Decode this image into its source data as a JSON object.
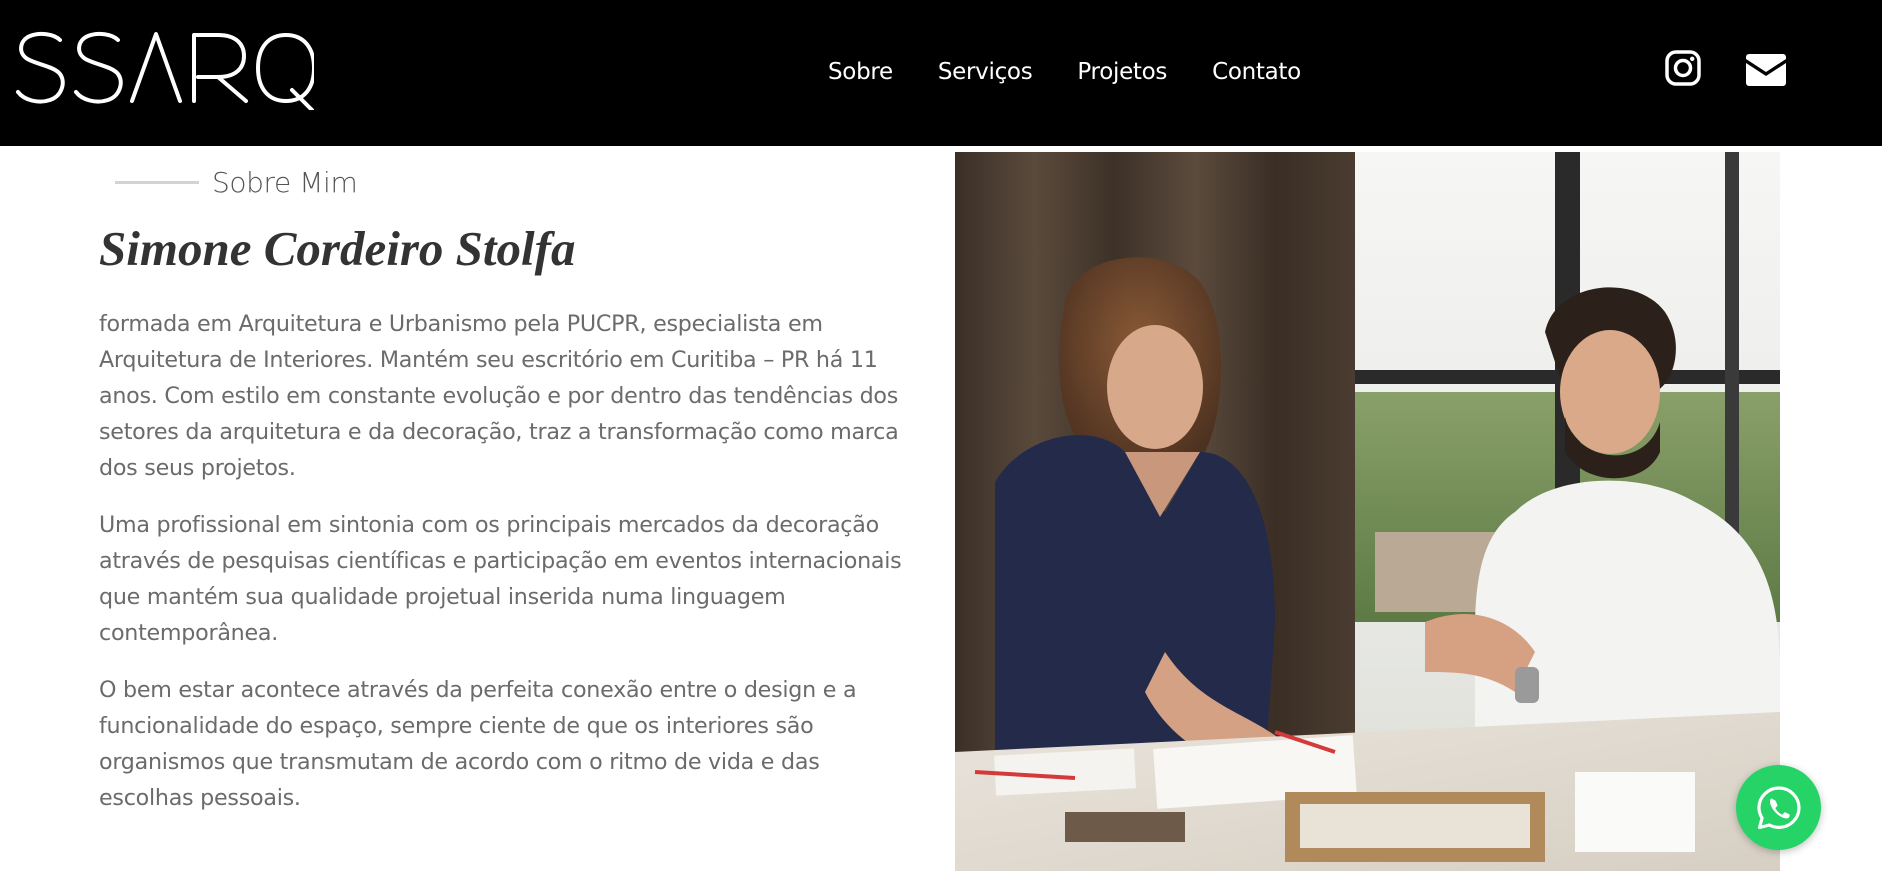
{
  "brand": {
    "logo_text": "SSARQ"
  },
  "nav": {
    "items": [
      {
        "label": "Sobre"
      },
      {
        "label": "Serviços"
      },
      {
        "label": "Projetos"
      },
      {
        "label": "Contato"
      }
    ]
  },
  "social": {
    "icons": [
      "instagram-icon",
      "envelope-icon"
    ]
  },
  "about": {
    "eyebrow": "Sobre Mim",
    "name": "Simone Cordeiro Stolfa",
    "paragraphs": [
      "formada em Arquitetura e Urbanismo pela PUCPR, especialista em Arquitetura de Interiores. Mantém seu escritório em Curitiba – PR há 11 anos. Com estilo em constante evolução e por dentro das tendências dos setores da arquitetura e da decoração, traz a transformação como marca dos seus projetos.",
      "Uma profissional em sintonia com os principais mercados da decoração através de pesquisas científicas e participação em eventos internacionais que mantém sua qualidade projetual inserida numa linguagem contemporânea.",
      "O bem estar acontece através da perfeita conexão entre o design e a funcionalidade do espaço, sempre ciente de que os interiores são organismos que transmutam de acordo com o ritmo de vida e das escolhas pessoais."
    ]
  },
  "colors": {
    "header_bg": "#000000",
    "text_body": "#6b6b6b",
    "heading": "#333333",
    "whatsapp": "#25d366"
  },
  "floating": {
    "icon": "whatsapp-icon"
  }
}
